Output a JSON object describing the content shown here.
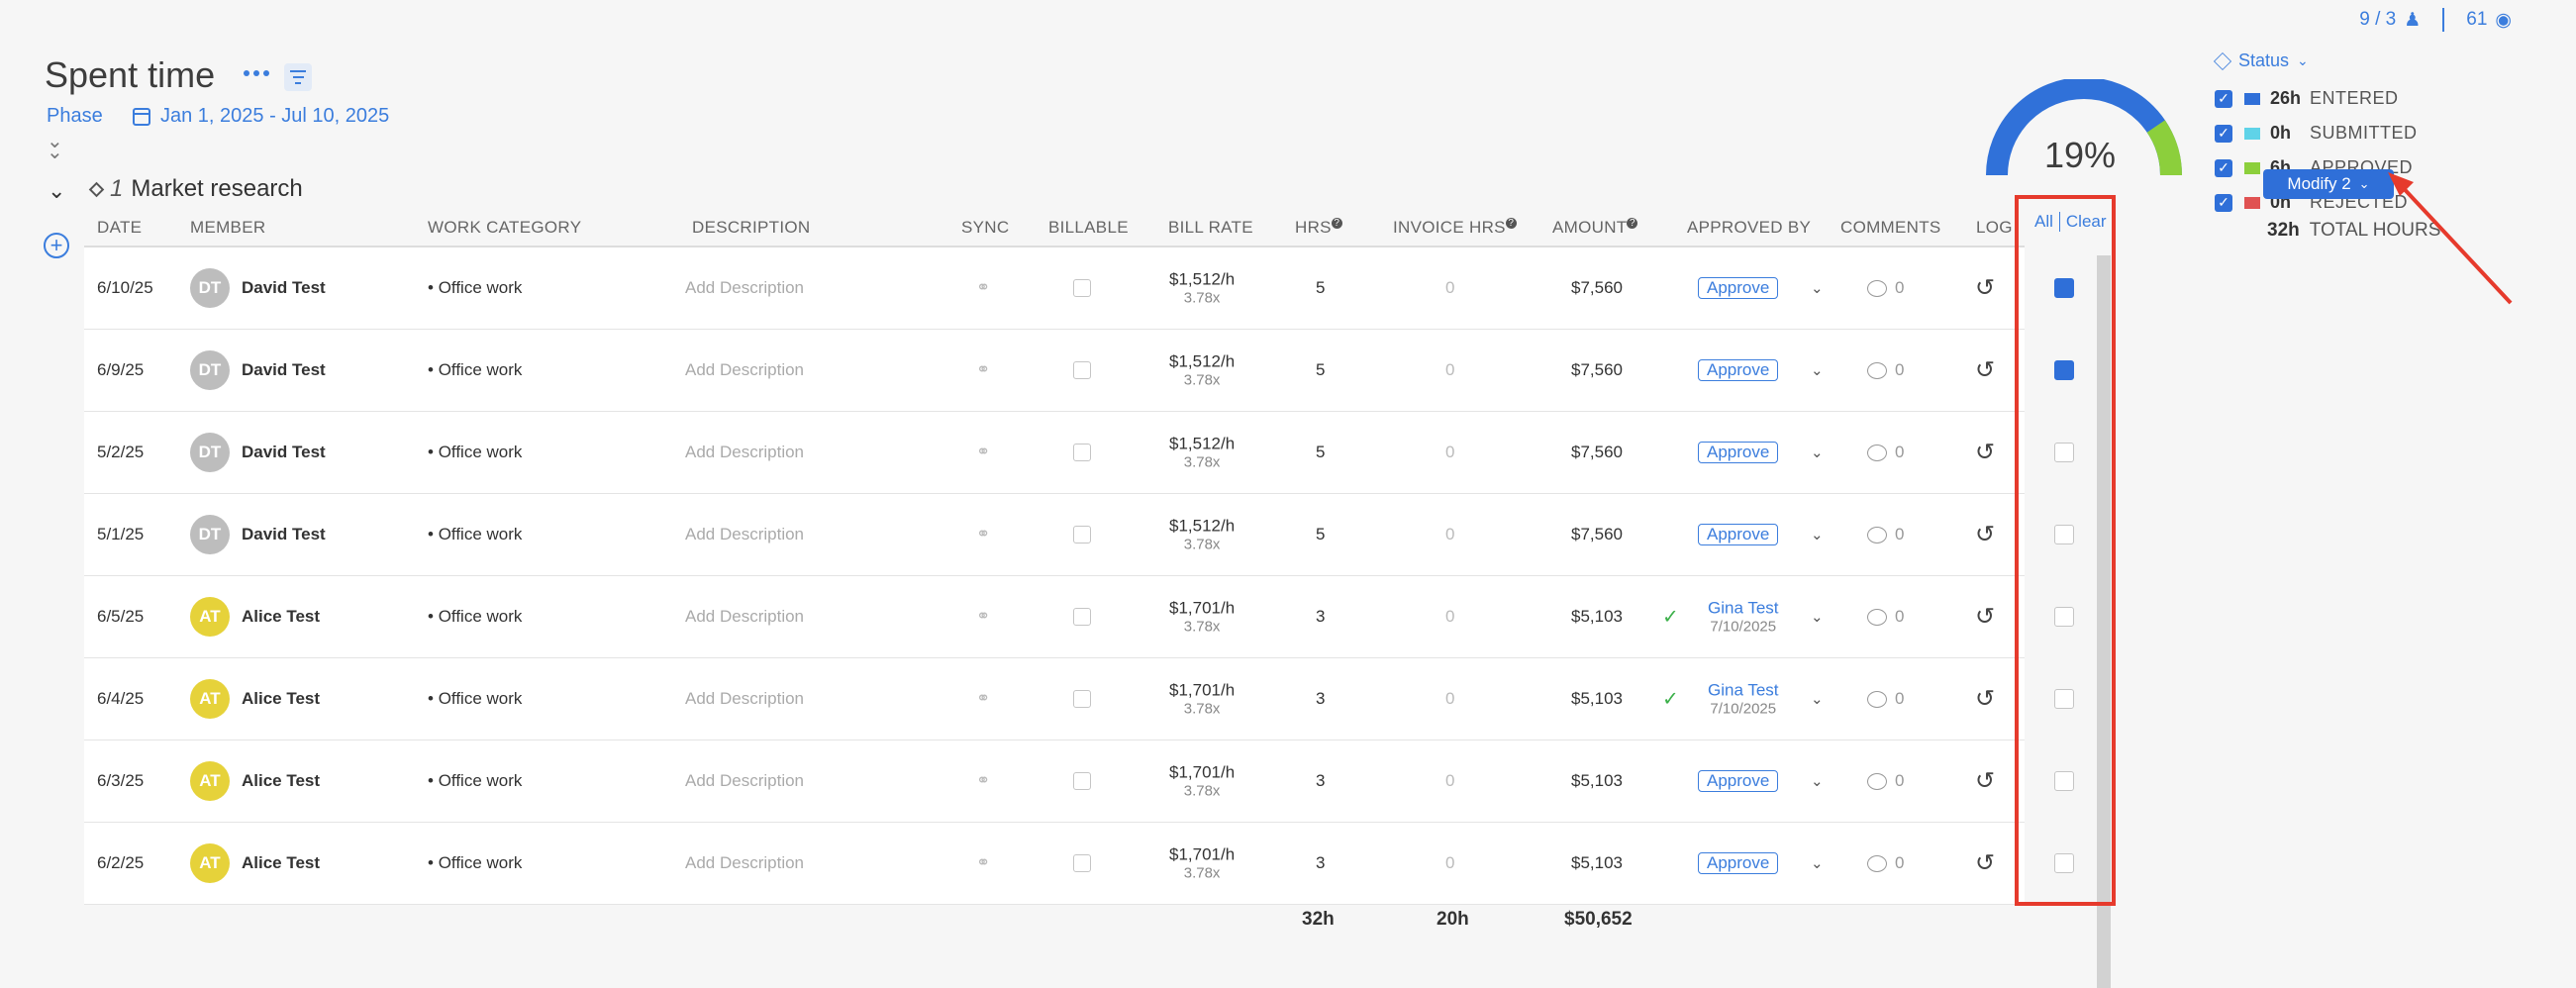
{
  "counters": {
    "members": "9 / 3",
    "views": "61"
  },
  "header": {
    "title": "Spent time",
    "phase_label": "Phase",
    "date_range": "Jan 1, 2025 - Jul 10, 2025"
  },
  "group": {
    "number": "1",
    "name": "Market research"
  },
  "columns": {
    "date": "DATE",
    "member": "MEMBER",
    "work_category": "WORK CATEGORY",
    "description": "DESCRIPTION",
    "sync": "SYNC",
    "billable": "BILLABLE",
    "bill_rate": "BILL RATE",
    "hrs": "HRS",
    "invoice_hrs": "INVOICE HRS",
    "amount": "AMOUNT",
    "approved_by": "APPROVED BY",
    "comments": "COMMENTS",
    "log": "LOG"
  },
  "select_controls": {
    "all": "All",
    "clear": "Clear"
  },
  "rows": [
    {
      "date": "6/10/25",
      "initials": "DT",
      "member": "David Test",
      "work_category": "Office work",
      "description": "Add Description",
      "rate": "$1,512/h",
      "multiplier": "3.78x",
      "hrs": "5",
      "invoice_hrs": "0",
      "amount": "$7,560",
      "approve_label": "Approve",
      "comments": "0",
      "selected": true
    },
    {
      "date": "6/9/25",
      "initials": "DT",
      "member": "David Test",
      "work_category": "Office work",
      "description": "Add Description",
      "rate": "$1,512/h",
      "multiplier": "3.78x",
      "hrs": "5",
      "invoice_hrs": "0",
      "amount": "$7,560",
      "approve_label": "Approve",
      "comments": "0",
      "selected": true
    },
    {
      "date": "5/2/25",
      "initials": "DT",
      "member": "David Test",
      "work_category": "Office work",
      "description": "Add Description",
      "rate": "$1,512/h",
      "multiplier": "3.78x",
      "hrs": "5",
      "invoice_hrs": "0",
      "amount": "$7,560",
      "approve_label": "Approve",
      "comments": "0",
      "selected": false
    },
    {
      "date": "5/1/25",
      "initials": "DT",
      "member": "David Test",
      "work_category": "Office work",
      "description": "Add Description",
      "rate": "$1,512/h",
      "multiplier": "3.78x",
      "hrs": "5",
      "invoice_hrs": "0",
      "amount": "$7,560",
      "approve_label": "Approve",
      "comments": "0",
      "selected": false
    },
    {
      "date": "6/5/25",
      "initials": "AT",
      "member": "Alice Test",
      "work_category": "Office work",
      "description": "Add Description",
      "rate": "$1,701/h",
      "multiplier": "3.78x",
      "hrs": "3",
      "invoice_hrs": "0",
      "amount": "$5,103",
      "approver": "Gina Test",
      "approved_date": "7/10/2025",
      "comments": "0",
      "selected": false
    },
    {
      "date": "6/4/25",
      "initials": "AT",
      "member": "Alice Test",
      "work_category": "Office work",
      "description": "Add Description",
      "rate": "$1,701/h",
      "multiplier": "3.78x",
      "hrs": "3",
      "invoice_hrs": "0",
      "amount": "$5,103",
      "approver": "Gina Test",
      "approved_date": "7/10/2025",
      "comments": "0",
      "selected": false
    },
    {
      "date": "6/3/25",
      "initials": "AT",
      "member": "Alice Test",
      "work_category": "Office work",
      "description": "Add Description",
      "rate": "$1,701/h",
      "multiplier": "3.78x",
      "hrs": "3",
      "invoice_hrs": "0",
      "amount": "$5,103",
      "approve_label": "Approve",
      "comments": "0",
      "selected": false
    },
    {
      "date": "6/2/25",
      "initials": "AT",
      "member": "Alice Test",
      "work_category": "Office work",
      "description": "Add Description",
      "rate": "$1,701/h",
      "multiplier": "3.78x",
      "hrs": "3",
      "invoice_hrs": "0",
      "amount": "$5,103",
      "approve_label": "Approve",
      "comments": "0",
      "selected": false
    }
  ],
  "totals": {
    "hrs": "32h",
    "invoice_hrs": "20h",
    "amount": "$50,652"
  },
  "gauge": {
    "percent_label": "19%",
    "fraction": 0.19,
    "colors": [
      "#3071d9",
      "#8ccf3c"
    ]
  },
  "status": {
    "label": "Status",
    "items": [
      {
        "hrs": "26h",
        "label": "ENTERED",
        "color": "#2f6fd8"
      },
      {
        "hrs": "0h",
        "label": "SUBMITTED",
        "color": "#5fd3e8"
      },
      {
        "hrs": "6h",
        "label": "APPROVED",
        "color": "#8ccf3c"
      },
      {
        "hrs": "0h",
        "label": "REJECTED",
        "color": "#e05252"
      }
    ],
    "total_hrs": "32h",
    "total_label": "TOTAL HOURS"
  },
  "modify_button": {
    "label": "Modify 2"
  },
  "accent_colors": {
    "primary": "#3b7ddd",
    "highlight": "#e63a2c"
  }
}
